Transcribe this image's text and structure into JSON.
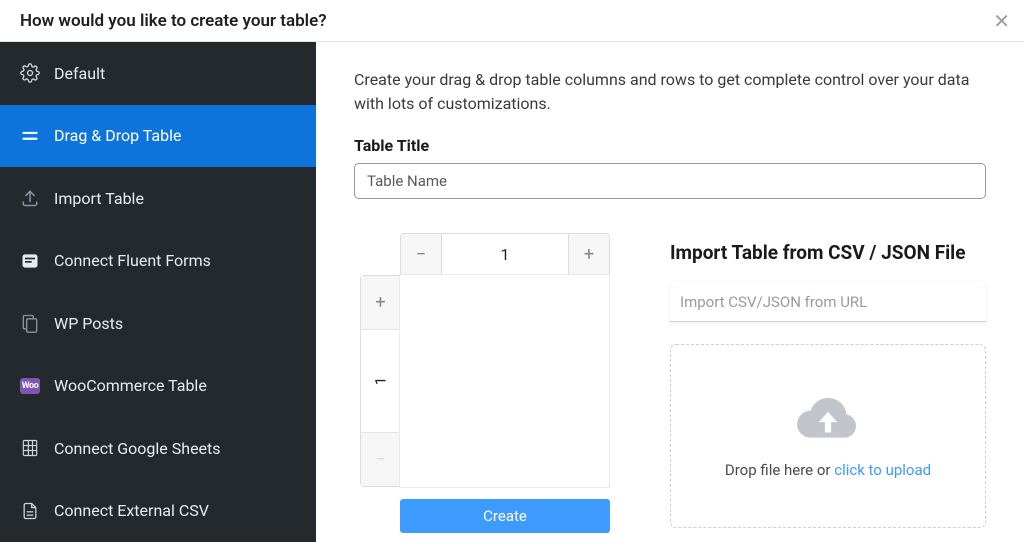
{
  "header": {
    "title": "How would you like to create your table?"
  },
  "sidebar": {
    "items": [
      {
        "label": "Default"
      },
      {
        "label": "Drag & Drop Table"
      },
      {
        "label": "Import Table"
      },
      {
        "label": "Connect Fluent Forms"
      },
      {
        "label": "WP Posts"
      },
      {
        "label": "WooCommerce Table"
      },
      {
        "label": "Connect Google Sheets"
      },
      {
        "label": "Connect External CSV"
      }
    ],
    "woo_badge": "Woo"
  },
  "main": {
    "intro": "Create your drag & drop table columns and rows to get complete control over your data with lots of customizations.",
    "table_title_label": "Table Title",
    "table_title_placeholder": "Table Name",
    "col_count": "1",
    "row_count": "1",
    "create_label": "Create"
  },
  "import": {
    "title": "Import Table from CSV / JSON File",
    "url_placeholder": "Import CSV/JSON from URL",
    "drop_text_prefix": "Drop file here or ",
    "drop_link": "click to upload"
  }
}
